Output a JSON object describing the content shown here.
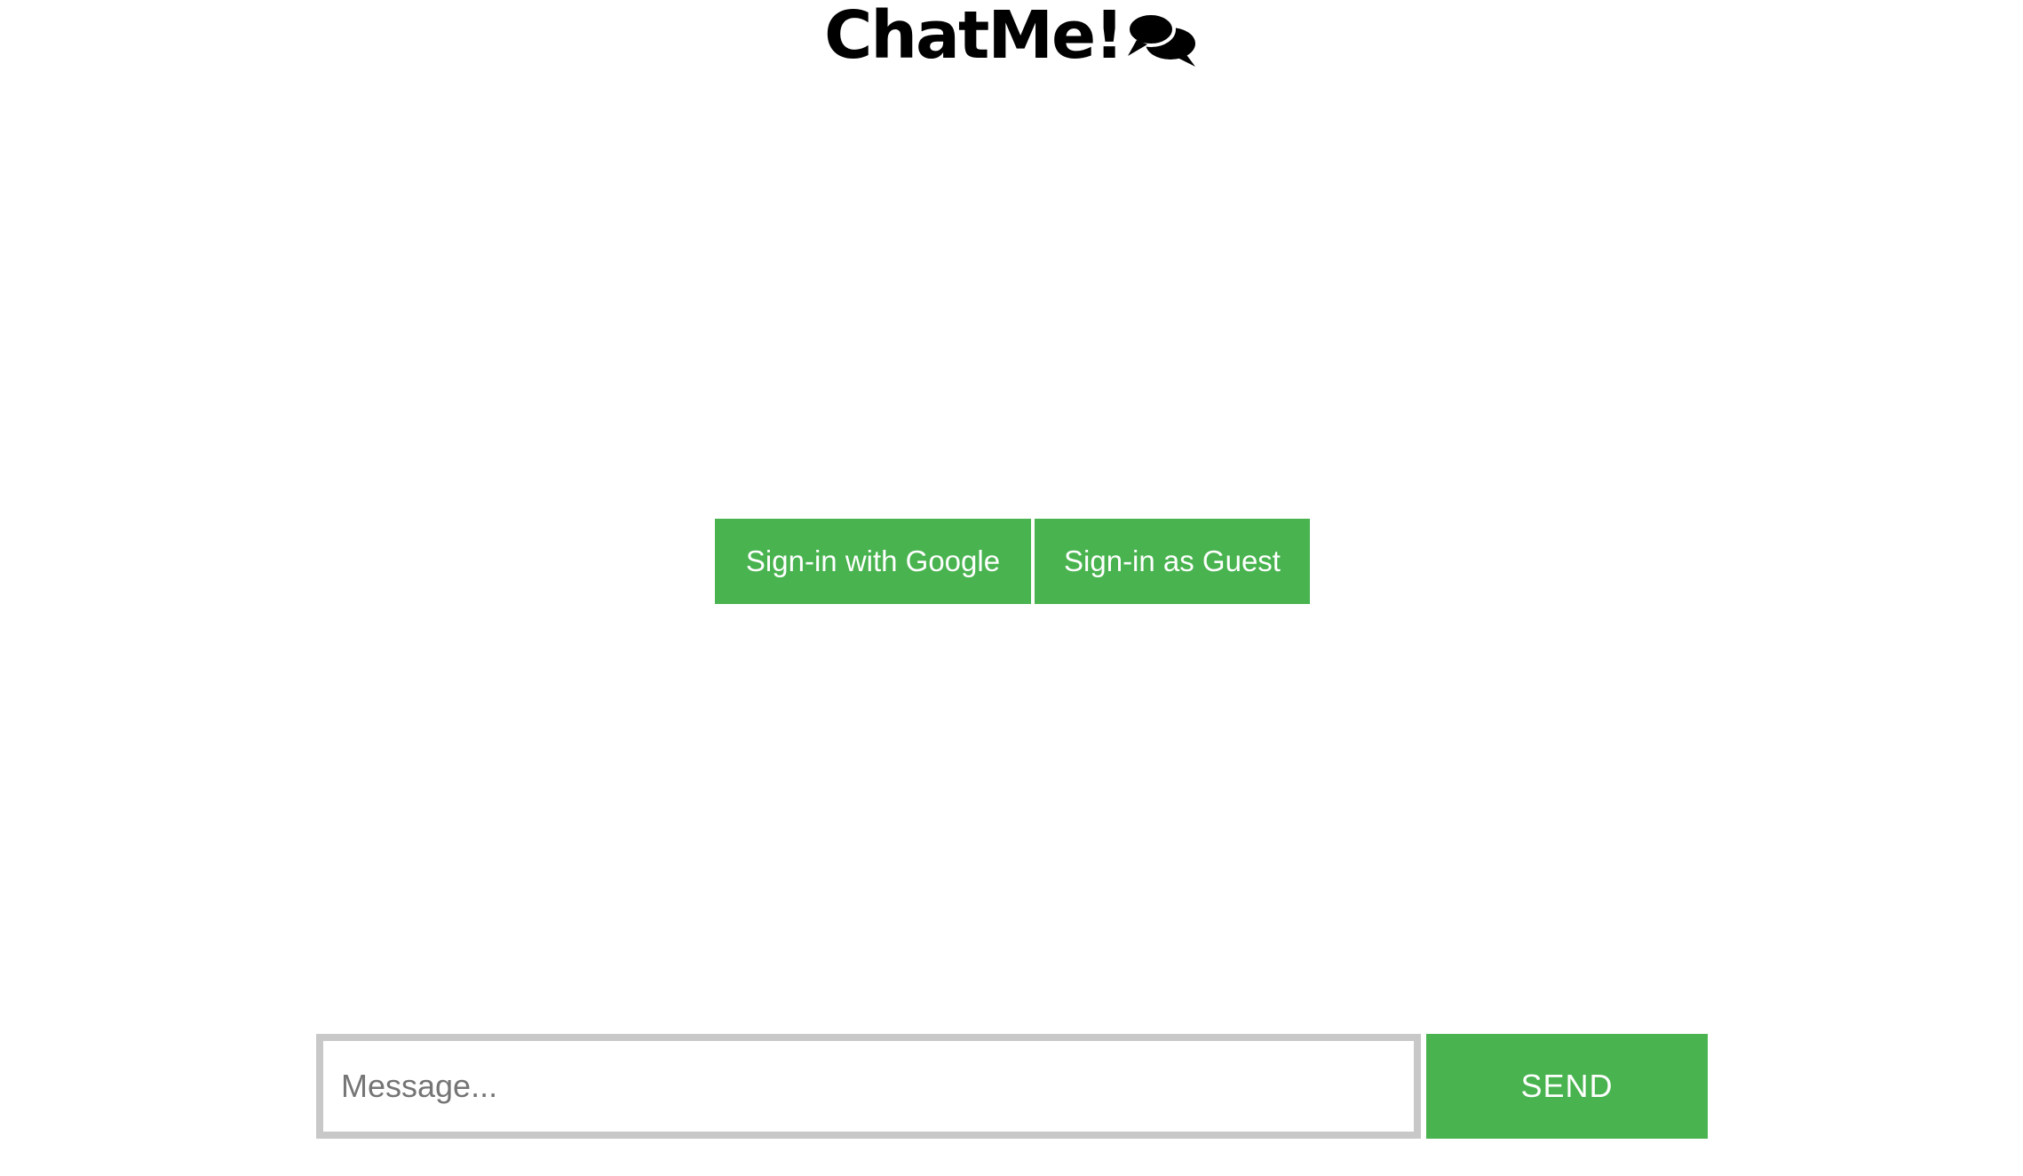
{
  "header": {
    "title": "ChatMe!",
    "icon": "chat-bubbles-icon"
  },
  "auth": {
    "google_label": "Sign-in with Google",
    "guest_label": "Sign-in as Guest"
  },
  "composer": {
    "value": "",
    "placeholder": "Message...",
    "send_label": "SEND"
  },
  "colors": {
    "accent": "#48b34f",
    "input_border": "#c8c8c8",
    "background": "#ffffff",
    "text": "#000000"
  }
}
